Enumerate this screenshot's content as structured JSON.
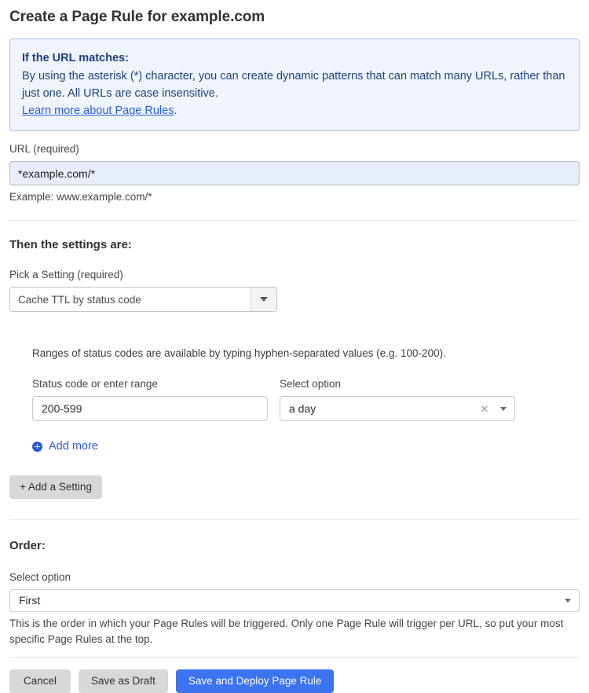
{
  "page_title": "Create a Page Rule for example.com",
  "info_box": {
    "title": "If the URL matches:",
    "body": "By using the asterisk (*) character, you can create dynamic patterns that can match many URLs, rather than just one. All URLs are case insensitive.",
    "link_text": "Learn more about Page Rules",
    "link_suffix": ".",
    "border_color": "#a9c2f2",
    "background_color": "#eff4fe",
    "text_color": "#21427e"
  },
  "url_field": {
    "label": "URL (required)",
    "value": "*example.com/*",
    "placeholder": "Enter URL pattern",
    "example": "Example: www.example.com/*",
    "background_color": "#e8edfb"
  },
  "settings_section": {
    "heading": "Then the settings are:",
    "pick_setting": {
      "label": "Pick a Setting (required)",
      "value": "Cache TTL by status code",
      "caret_icon": "chevron-down-icon"
    },
    "note": "Ranges of status codes are available by typing hyphen-separated values (e.g. 100-200).",
    "status_code": {
      "label": "Status code or enter range",
      "value": "200-599",
      "placeholder": "Status code or enter range"
    },
    "select_option": {
      "label": "Select option",
      "value": "a day",
      "clear_icon": "close-icon",
      "caret_icon": "chevron-down-icon"
    },
    "add_more": {
      "label": "Add more",
      "icon": "plus-circle-icon",
      "color": "#2b5bd7"
    },
    "add_setting_label": "+ Add a Setting"
  },
  "order_section": {
    "heading": "Order:",
    "select_label": "Select option",
    "value": "First",
    "caret_icon": "chevron-down-icon",
    "help": "This is the order in which your Page Rules will be triggered. Only one Page Rule will trigger per URL, so put your most specific Page Rules at the top."
  },
  "footer": {
    "cancel_label": "Cancel",
    "draft_label": "Save as Draft",
    "deploy_label": "Save and Deploy Page Rule",
    "primary_color": "#3b73f0",
    "secondary_color": "#d8d8d8"
  }
}
